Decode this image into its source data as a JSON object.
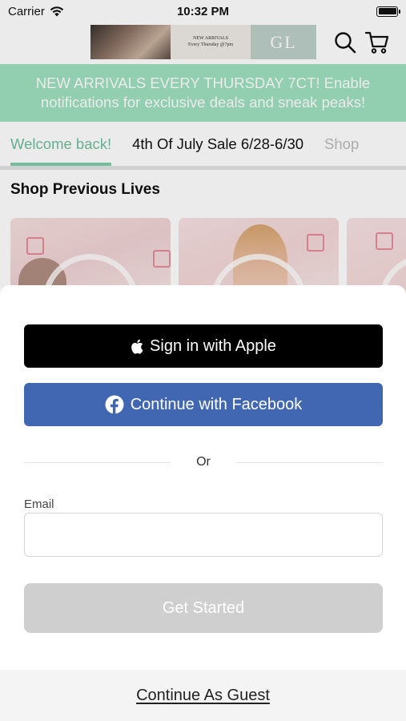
{
  "status_bar": {
    "carrier": "Carrier",
    "time": "10:32 PM",
    "battery_level": 1.0
  },
  "header": {
    "banner_text_line1": "NEW ARRIVALS",
    "banner_text_line2": "Every Thursday @7pm",
    "banner_logo": "GL",
    "search_icon": "search-icon",
    "cart_icon": "cart-icon"
  },
  "announcement": {
    "text": "NEW ARRIVALS EVERY THURSDAY 7CT! Enable notifications for exclusive deals and sneak peaks!"
  },
  "tabs": [
    {
      "label": "Welcome back!",
      "active": true
    },
    {
      "label": "4th Of July Sale 6/28-6/30",
      "active": false
    },
    {
      "label": "Shop",
      "active": false
    }
  ],
  "section": {
    "title": "Shop Previous Lives"
  },
  "login": {
    "apple_label": "Sign in with Apple",
    "facebook_label": "Continue with Facebook",
    "or_label": "Or",
    "email_label": "Email",
    "email_value": "",
    "email_placeholder": "",
    "get_started_label": "Get Started",
    "guest_label": "Continue As Guest"
  },
  "colors": {
    "accent_green": "#9fe0bf",
    "tab_active": "#6fbf9d",
    "facebook_blue": "#4267b2",
    "apple_black": "#000000",
    "disabled_gray": "#cfcfcf"
  }
}
